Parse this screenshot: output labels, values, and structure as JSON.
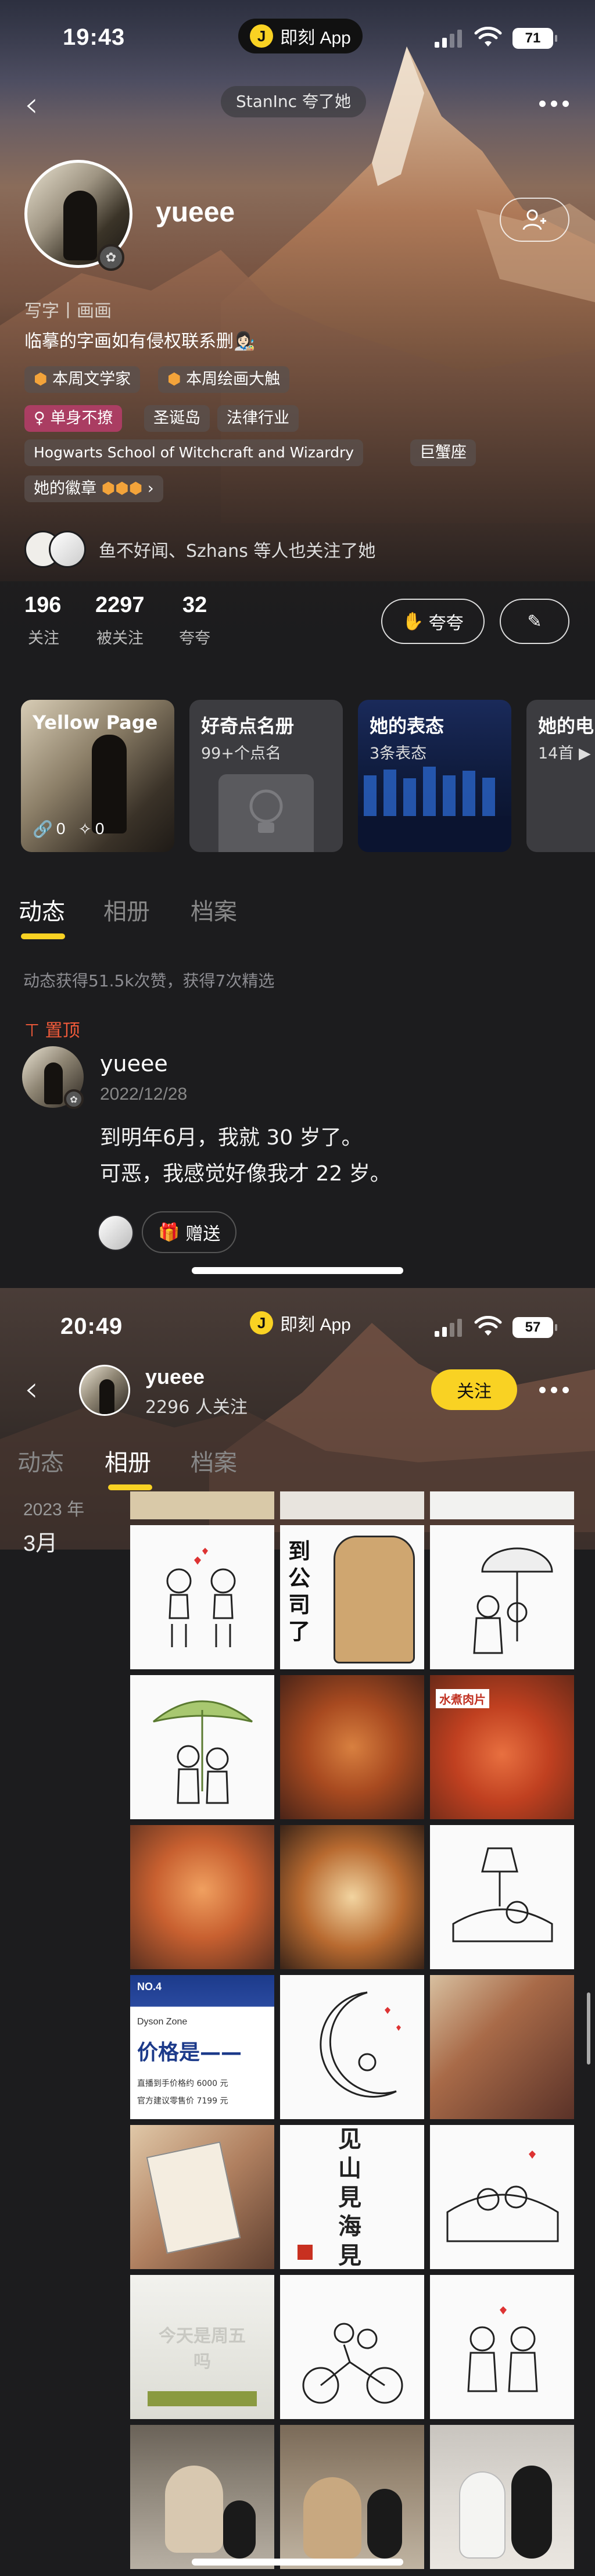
{
  "screen1": {
    "status": {
      "time": "19:43",
      "app_pill": "即刻 App",
      "app_pill_icon": "J",
      "battery": "71"
    },
    "header": {
      "praise_chip": "StanInc 夸了她"
    },
    "profile": {
      "username": "yueee",
      "bio_line1": "写字丨画画",
      "bio_line2": "临摹的字画如有侵权联系删👩🏻‍🎨",
      "tags": [
        "本周文学家",
        "本周绘画大触",
        "♀ 单身不撩",
        "圣诞岛",
        "法律行业",
        "Hogwarts School of Witchcraft and Wizardry",
        "巨蟹座"
      ],
      "badges_label": "她的徽章",
      "mutual_text": "鱼不好闻、Szhans 等人也关注了她"
    },
    "stats": [
      {
        "num": "196",
        "label": "关注"
      },
      {
        "num": "2297",
        "label": "被关注"
      },
      {
        "num": "32",
        "label": "夸夸"
      }
    ],
    "actions": {
      "praise_button": "夸夸"
    },
    "cards": [
      {
        "title": "Yellow Page",
        "likes": "0",
        "shares": "0"
      },
      {
        "title": "好奇点名册",
        "subtitle": "99+个点名"
      },
      {
        "title": "她的表态",
        "subtitle": "3条表态"
      },
      {
        "title": "她的电",
        "subtitle": "14首 ▶"
      }
    ],
    "tabs": [
      "动态",
      "相册",
      "档案"
    ],
    "summary": "动态获得51.5k次赞，获得7次精选",
    "post": {
      "pinned": "置顶",
      "author": "yueee",
      "date": "2022/12/28",
      "line1": "到明年6月，我就 30 岁了。",
      "line2": "可恶，我感觉好像我才 22 岁。",
      "gift_label": "赠送"
    }
  },
  "screen2": {
    "status": {
      "time": "20:49",
      "app_pill": "即刻 App",
      "app_pill_icon": "J",
      "battery": "57"
    },
    "header": {
      "username": "yueee",
      "followers": "2296 人关注",
      "follow_button": "关注"
    },
    "tabs": [
      "动态",
      "相册",
      "档案"
    ],
    "year": "2023 年",
    "month": "3月",
    "photo_texts": {
      "company": "到公司了",
      "dyson_tag": "NO.4",
      "dyson_brand": "Dyson Zone",
      "dyson_price": "价格是——",
      "dyson_line1": "直播到手价格约 6000 元",
      "dyson_line2": "官方建议零售价 7199 元",
      "poem": "见山見海見自己",
      "friday": "今天是周五吗",
      "food_label": "水煮肉片"
    }
  },
  "colors": {
    "accent": "#f9d223",
    "pinned": "#f05a3a",
    "tag_pink": "#be3c6e"
  }
}
